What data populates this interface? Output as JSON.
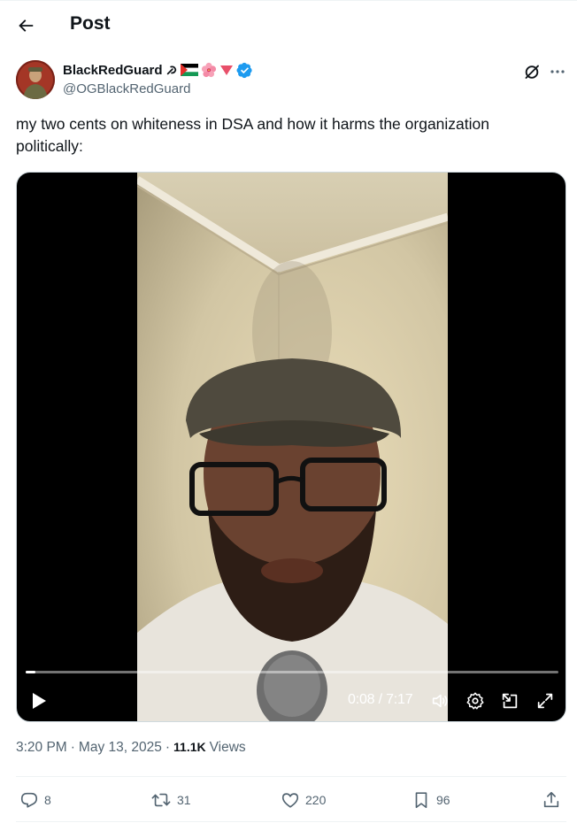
{
  "header": {
    "title": "Post",
    "back_icon": "arrow-left-icon"
  },
  "author": {
    "name": "BlackRedGuard",
    "name_emojis": [
      "☭",
      "palestine-flag",
      "🌺",
      "🔻"
    ],
    "verified": true,
    "handle": "@OGBlackRedGuard"
  },
  "tweet": {
    "text": "my two cents on whiteness in DSA and how it harms the organization politically:"
  },
  "video": {
    "current_time": "0:08",
    "duration": "7:17",
    "timecode": "0:08 / 7:17",
    "progress": 0.018
  },
  "meta": {
    "time": "3:20 PM",
    "date": "May 13, 2025",
    "views_count": "11.1K",
    "views_label": "Views"
  },
  "actions": {
    "replies": "8",
    "retweets": "31",
    "likes": "220",
    "bookmarks": "96"
  },
  "colors": {
    "text": "#0f1419",
    "secondary": "#536471",
    "verified_blue": "#1d9bf0",
    "divider": "#eff3f4"
  }
}
